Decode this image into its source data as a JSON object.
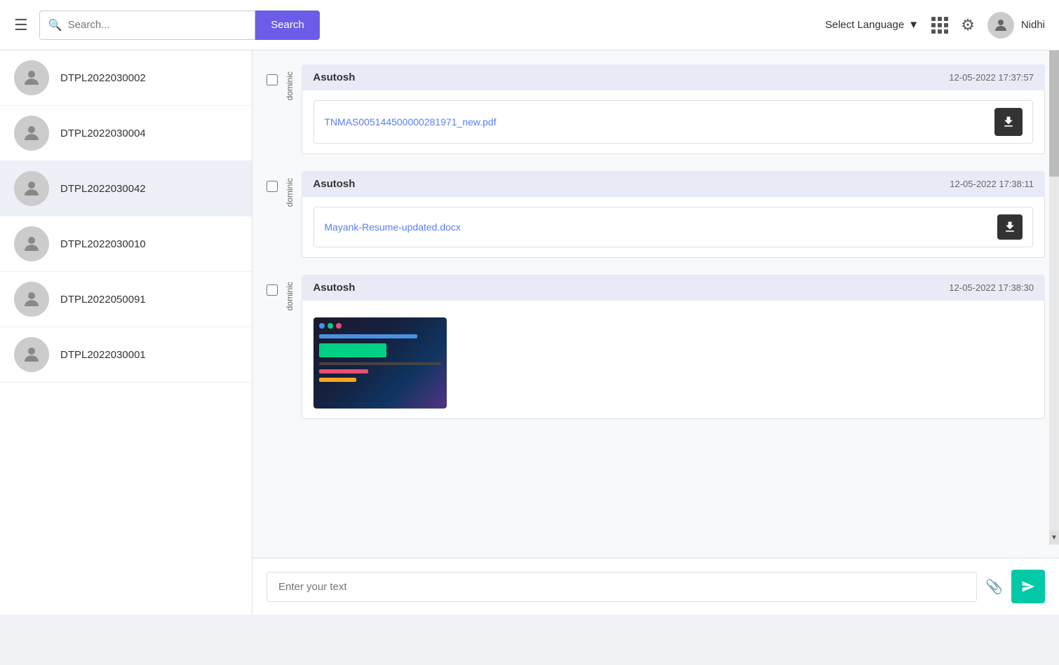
{
  "header": {
    "search_placeholder": "Search...",
    "search_button": "Search",
    "language_selector": "Select Language",
    "username": "Nidhi"
  },
  "sidebar": {
    "contacts": [
      {
        "id": "DTPL2022030002",
        "active": false
      },
      {
        "id": "DTPL2022030004",
        "active": false
      },
      {
        "id": "DTPL2022030042",
        "active": true
      },
      {
        "id": "DTPL2022030010",
        "active": false
      },
      {
        "id": "DTPL2022050091",
        "active": false
      },
      {
        "id": "DTPL2022030001",
        "active": false
      }
    ]
  },
  "chat": {
    "messages": [
      {
        "sender_label": "dominic",
        "sender_name": "Asutosh",
        "timestamp": "12-05-2022 17:37:57",
        "type": "file",
        "file_name": "TNMAS005144500000281971_new.pdf"
      },
      {
        "sender_label": "dominic",
        "sender_name": "Asutosh",
        "timestamp": "12-05-2022 17:38:11",
        "type": "file",
        "file_name": "Mayank-Resume-updated.docx"
      },
      {
        "sender_label": "dominic",
        "sender_name": "Asutosh",
        "timestamp": "12-05-2022 17:38:30",
        "type": "image"
      }
    ],
    "input_placeholder": "Enter your text"
  }
}
